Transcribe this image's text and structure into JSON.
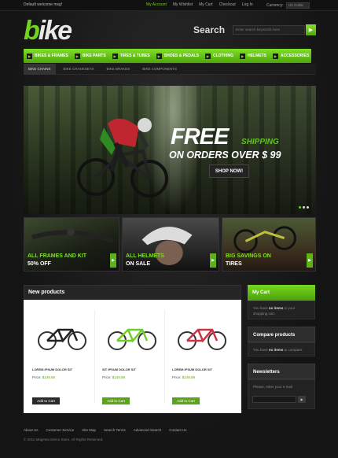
{
  "topbar": {
    "welcome": "Default welcome msg!",
    "links": [
      "My Account",
      "My Wishlist",
      "My Cart",
      "Checkout",
      "Log In"
    ],
    "currency_label": "Currency:",
    "currency_value": "US Dollar"
  },
  "header": {
    "logo_initial": "b",
    "logo_rest": "ike",
    "search_label": "Search",
    "search_placeholder": "Enter search keywords here",
    "search_icon": "arrow-right-icon"
  },
  "nav": {
    "items": [
      "Bikes & Frames",
      "Bike Parts",
      "Tires & Tubes",
      "Shoes & Pedals",
      "Clothing",
      "Helmets",
      "Accessories"
    ],
    "sub_items": [
      "Bike Chains",
      "Bike Cranksets",
      "Bike Brakes",
      "Bike Components"
    ]
  },
  "hero": {
    "free": "FREE",
    "shipping": "SHIPPING",
    "orders": "ON ORDERS OVER $ 99",
    "cta": "SHOP NOW!"
  },
  "tiles": [
    {
      "line1": "All Frames and Kit",
      "line2": "50% OFF"
    },
    {
      "line1": "All Helmets",
      "line2": "On Sale"
    },
    {
      "line1": "Big Savings On",
      "line2": "Tires"
    }
  ],
  "products": {
    "heading": "New products",
    "items": [
      {
        "name": "LOREM IPSUM DOLOR SIT",
        "price_label": "Price:",
        "price": "$149.59",
        "cart": "Add to Cart",
        "frame_color": "#222222"
      },
      {
        "name": "SIT IPSUM DOLOR SIT",
        "price_label": "Price:",
        "price": "$149.59",
        "cart": "Add to Cart",
        "frame_color": "#6fcf2a"
      },
      {
        "name": "LOREM IPSUM DOLOR SIT",
        "price_label": "Price:",
        "price": "$149.59",
        "cart": "Add to Cart",
        "frame_color": "#cc3344"
      }
    ]
  },
  "sidebar": {
    "cart_title": "My Cart",
    "cart_text_pre": "You have",
    "cart_text_bold": "no items",
    "cart_text_post": "in your shopping cart.",
    "compare_title": "Compare products",
    "compare_text_pre": "You have",
    "compare_text_bold": "no items",
    "compare_text_post": "to compare.",
    "newsletter_title": "Newsletters",
    "newsletter_text": "Please, enter your e-mail"
  },
  "footer": {
    "links": [
      "About Us",
      "Customer Service",
      "Site Map",
      "Search Terms",
      "Advanced Search",
      "Contact Us"
    ],
    "copyright": "© 2011 Magento Demo Store. All Rights Reserved."
  },
  "colors": {
    "accent": "#6fce1c",
    "background": "#1a1a1a"
  }
}
